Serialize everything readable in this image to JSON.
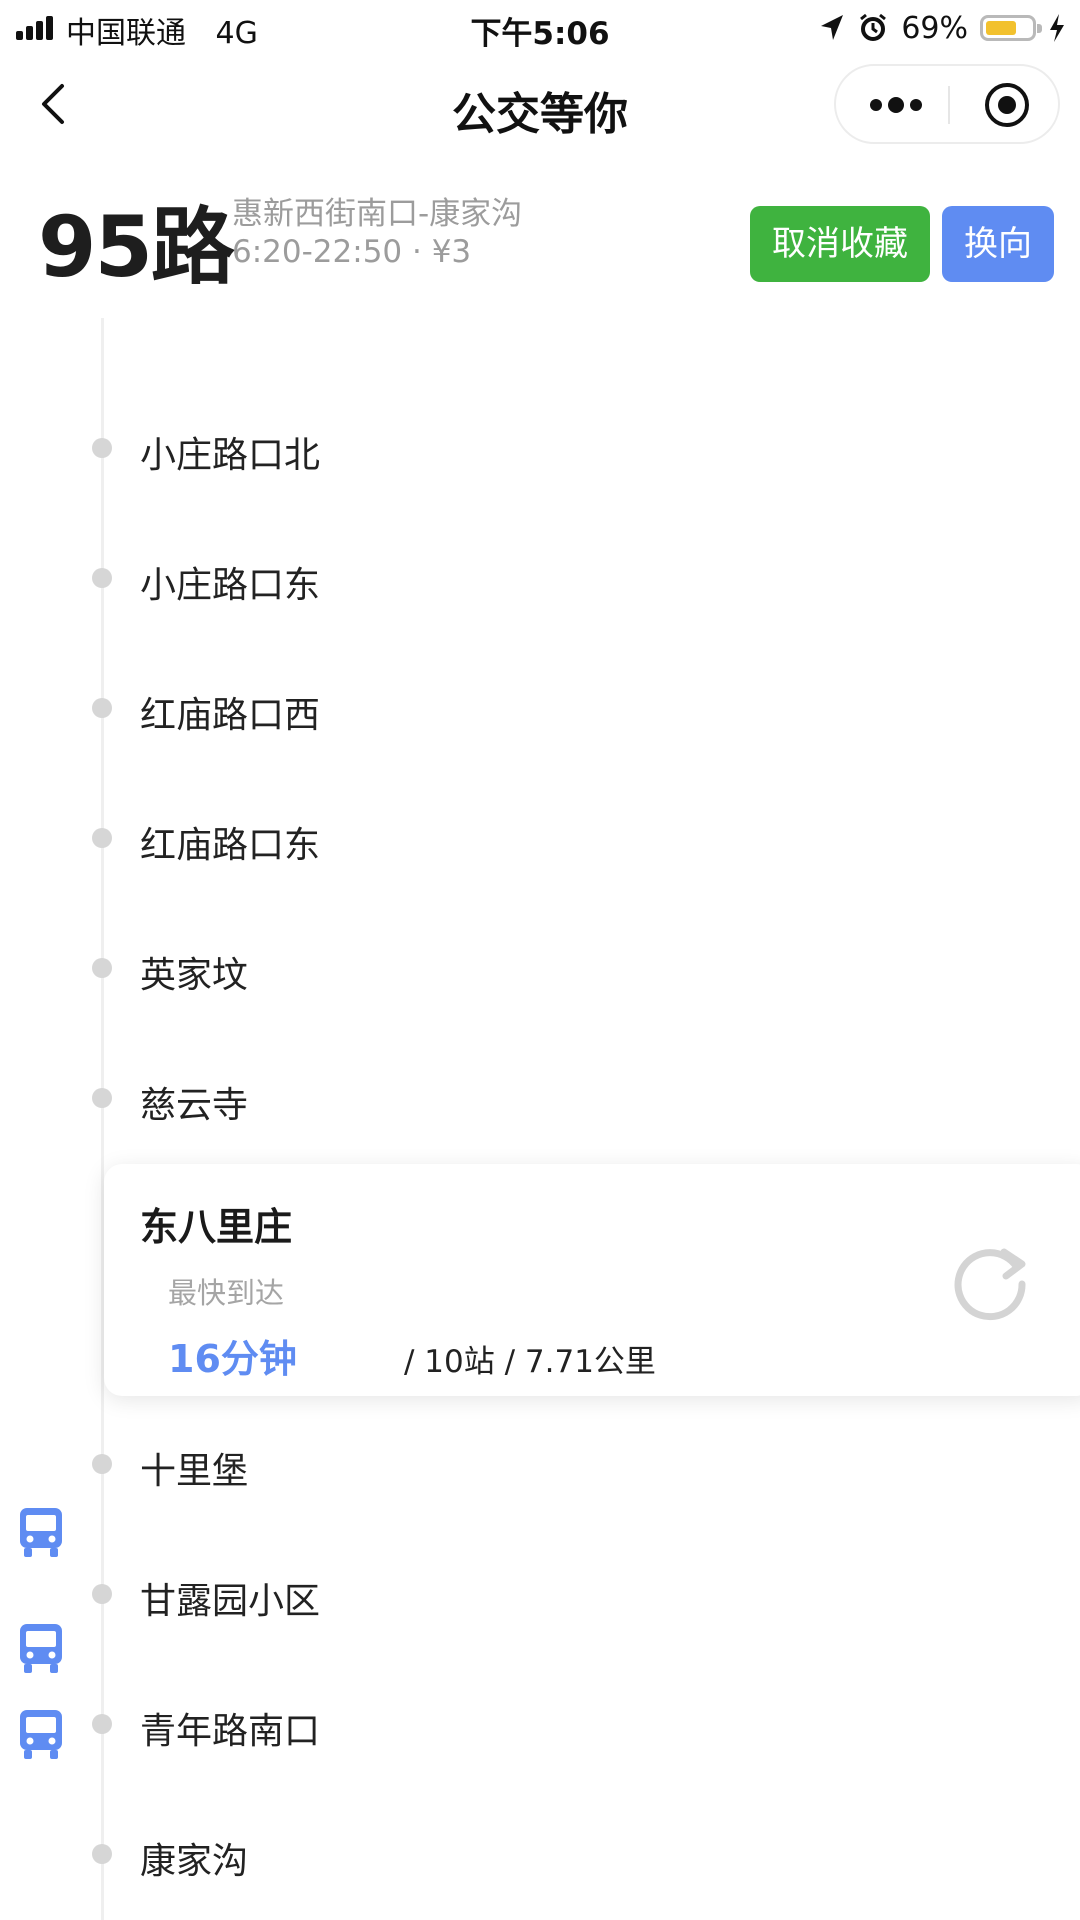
{
  "status_bar": {
    "carrier": "中国联通",
    "network": "4G",
    "time": "下午5:06",
    "battery_percent": "69%",
    "battery_level": 0.69,
    "icons": [
      "signal-icon",
      "location-arrow-icon",
      "alarm-icon",
      "battery-icon",
      "charging-bolt-icon"
    ]
  },
  "nav": {
    "title": "公交等你",
    "icons": [
      "back-chevron-icon",
      "more-dots-icon",
      "close-target-icon"
    ]
  },
  "route": {
    "number": "95路",
    "terminals": "惠新西街南口-康家沟",
    "hours_fare": "6:20-22:50 · ¥3",
    "unfavorite_label": "取消收藏",
    "reverse_label": "换向"
  },
  "stops_above": [
    "小庄路口北",
    "小庄路口东",
    "红庙路口西",
    "红庙路口东",
    "英家坟",
    "慈云寺"
  ],
  "selected_stop": {
    "name": "东八里庄",
    "subtitle": "最快到达",
    "eta": "16分钟",
    "detail": "/ 10站 / 7.71公里"
  },
  "stops_below": [
    "十里堡",
    "甘露园小区",
    "青年路南口",
    "康家沟"
  ],
  "colors": {
    "accent_blue": "#5f8cf2",
    "favorite_green": "#3fb33f",
    "battery_yellow": "#f2c12e"
  }
}
